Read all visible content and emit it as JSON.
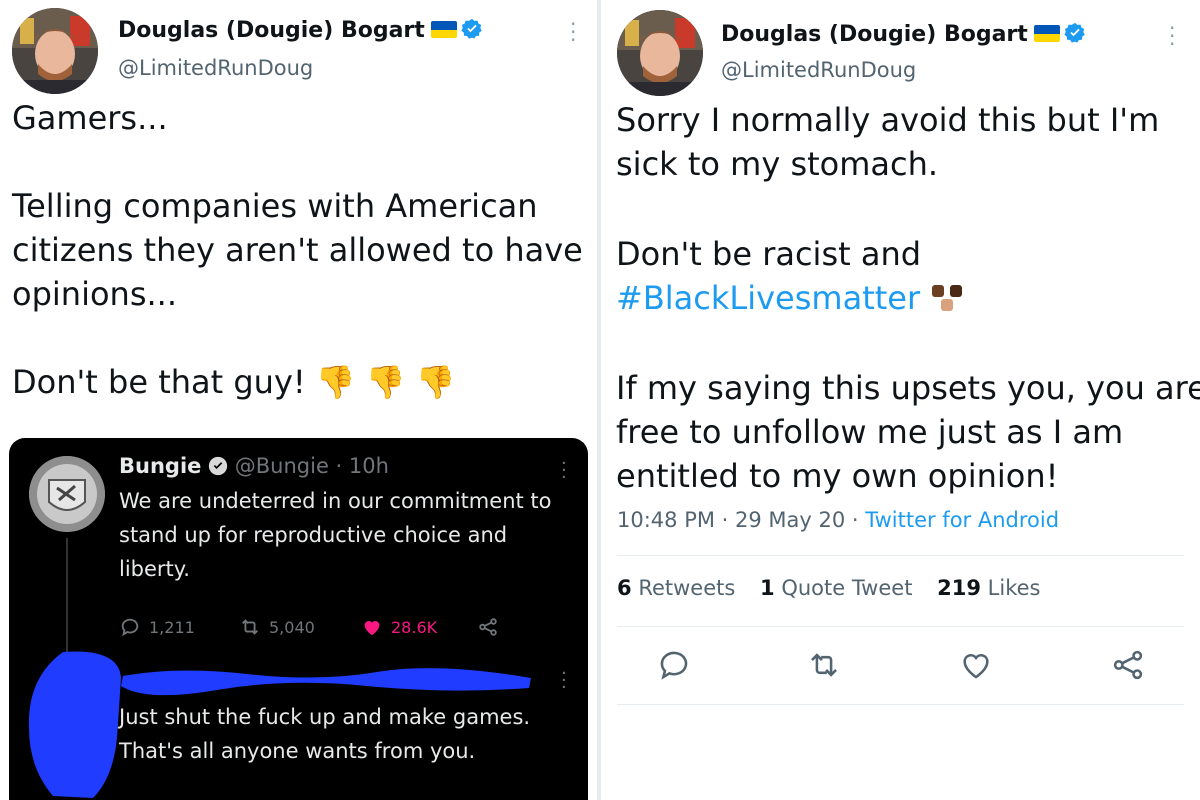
{
  "left_tweet": {
    "author_name": "Douglas (Dougie) Bogart",
    "handle": "@LimitedRunDoug",
    "more_icon": "more-vertical-icon",
    "text_lines": [
      "Gamers...",
      "",
      "Telling companies with American",
      "citizens they aren't allowed to have",
      "opinions...",
      "",
      "Don't be that guy!"
    ],
    "emoji": "👎👎👎",
    "quoted_tweet": {
      "author": "Bungie",
      "handle_time": "@Bungie · 10h",
      "text_lines": [
        "We are undeterred in our commitment to",
        "stand up for reproductive choice and",
        "liberty."
      ],
      "replies": "1,211",
      "retweets": "5,040",
      "likes": "28.6K",
      "reply_lines": [
        "Just shut the fuck up and make games.",
        "That's all anyone wants from you."
      ]
    }
  },
  "right_tweet": {
    "author_name": "Douglas (Dougie) Bogart",
    "handle": "@LimitedRunDoug",
    "more_icon": "more-vertical-icon",
    "line1": "Sorry I normally avoid this but I'm",
    "line2": "sick to my stomach.",
    "line3": "Don't be racist and",
    "hashtag": "#BlackLivesmatter",
    "line5": "If my saying this upsets you, you are",
    "line6": "free to unfollow me just as I am",
    "line7": "entitled to my own opinion!",
    "timestamp": "10:48 PM · 29 May 20 · ",
    "source": "Twitter for Android",
    "retweets_count": "6",
    "retweets_label": "Retweets",
    "quotes_count": "1",
    "quotes_label": "Quote Tweet",
    "likes_count": "219",
    "likes_label": "Likes"
  },
  "colors": {
    "link_blue": "#1d9bf0",
    "verified_blue": "#1d9bf0",
    "like_pink": "#f91880",
    "flag_blue": "#0057b7",
    "flag_yellow": "#ffd700",
    "scribble_blue": "#1f3cff"
  }
}
